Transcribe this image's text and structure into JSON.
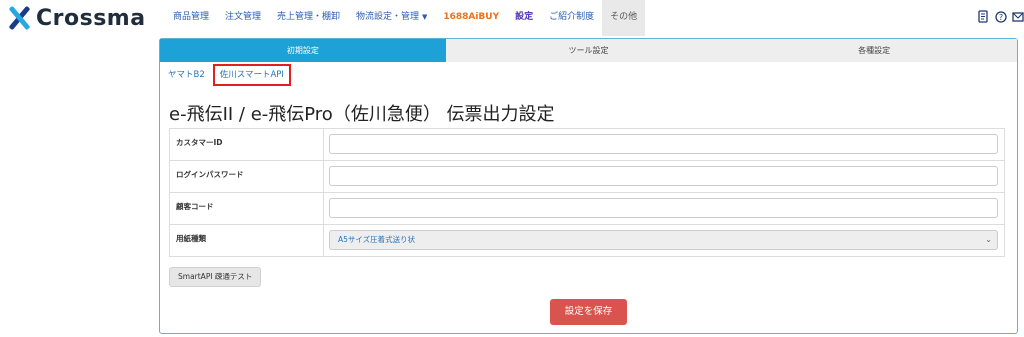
{
  "logo": {
    "text": "Crossma"
  },
  "nav": {
    "items": [
      {
        "label": "商品管理"
      },
      {
        "label": "注文管理"
      },
      {
        "label": "売上管理・棚卸"
      },
      {
        "label": "物流設定・管理"
      },
      {
        "label": "1688AiBUY"
      },
      {
        "label": "設定"
      },
      {
        "label": "ご紹介制度"
      },
      {
        "label": "その他"
      }
    ]
  },
  "top_icons": [
    "document-icon",
    "help-icon",
    "mail-icon"
  ],
  "tabs": [
    {
      "label": "初期設定"
    },
    {
      "label": "ツール設定"
    },
    {
      "label": "各種設定"
    }
  ],
  "subtabs": [
    {
      "label": "ヤマトB2"
    },
    {
      "label": "佐川スマートAPI"
    }
  ],
  "page": {
    "title": "e-飛伝II / e-飛伝Pro（佐川急便） 伝票出力設定"
  },
  "form": {
    "customer_id_label": "カスタマーID",
    "customer_id_value": "",
    "password_label": "ログインパスワード",
    "password_value": "",
    "client_code_label": "顧客コード",
    "client_code_value": "",
    "paper_type_label": "用紙種類",
    "paper_type_selected": "A5サイズ圧着式送り状"
  },
  "buttons": {
    "test_label": "SmartAPI 疎通テスト",
    "save_label": "設定を保存"
  },
  "colors": {
    "accent": "#1da1d6",
    "save": "#d9534f",
    "highlight_border": "#e02020",
    "nav_link": "#2a5db0",
    "nav_orange": "#e8731d",
    "nav_purple": "#4a2fb8"
  }
}
